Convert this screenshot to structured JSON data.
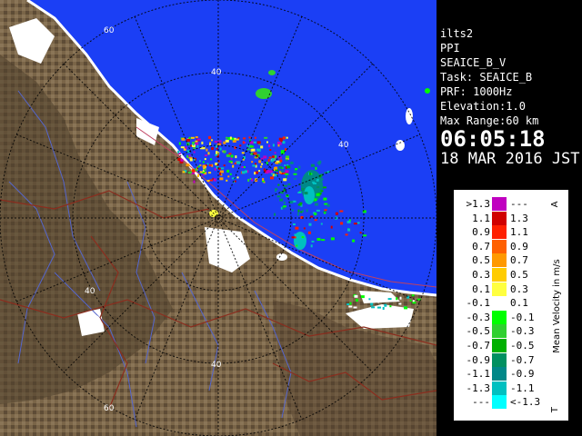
{
  "radar": {
    "range_ring_labels": [
      "40",
      "40",
      "40",
      "40",
      "60",
      "60"
    ],
    "colors": {
      "sea": "#1b3ff5",
      "land": "#7a6548",
      "land_dark": "#4f3f2c",
      "snow": "#ffffff",
      "coast": "#ffffff",
      "grid": "#000000",
      "rivers": "#5566cc",
      "borders": "#8b2d1e"
    }
  },
  "info": {
    "station": "ilts2",
    "mode": "PPI",
    "product": "SEAICE_B_V",
    "task": "Task: SEAICE_B",
    "prf": "PRF: 1000Hz",
    "elevation": "Elevation:1.0",
    "max_range": "Max Range:60 km",
    "time": "06:05:18",
    "date": "18 MAR 2016 JST"
  },
  "legend": {
    "title": "Mean Velocity in m/s",
    "top_marker": "A",
    "bottom_marker": "T",
    "rows": [
      {
        "left": ">1.3",
        "right": "---",
        "color": "#c000c0"
      },
      {
        "left": "1.1",
        "right": "1.3",
        "color": "#d00000"
      },
      {
        "left": "0.9",
        "right": "1.1",
        "color": "#ff2000"
      },
      {
        "left": "0.7",
        "right": "0.9",
        "color": "#ff6000"
      },
      {
        "left": "0.5",
        "right": "0.7",
        "color": "#ff9900"
      },
      {
        "left": "0.3",
        "right": "0.5",
        "color": "#ffcc00"
      },
      {
        "left": "0.1",
        "right": "0.3",
        "color": "#ffff40"
      },
      {
        "left": "-0.1",
        "right": "0.1",
        "color": "#ffffff"
      },
      {
        "left": "-0.3",
        "right": "-0.1",
        "color": "#00ff00"
      },
      {
        "left": "-0.5",
        "right": "-0.3",
        "color": "#30d030"
      },
      {
        "left": "-0.7",
        "right": "-0.5",
        "color": "#00b000"
      },
      {
        "left": "-0.9",
        "right": "-0.7",
        "color": "#009060"
      },
      {
        "left": "-1.1",
        "right": "-0.9",
        "color": "#008888"
      },
      {
        "left": "-1.3",
        "right": "-1.1",
        "color": "#00c0c0"
      },
      {
        "left": "---",
        "right": "<-1.3",
        "color": "#00ffff"
      }
    ]
  }
}
